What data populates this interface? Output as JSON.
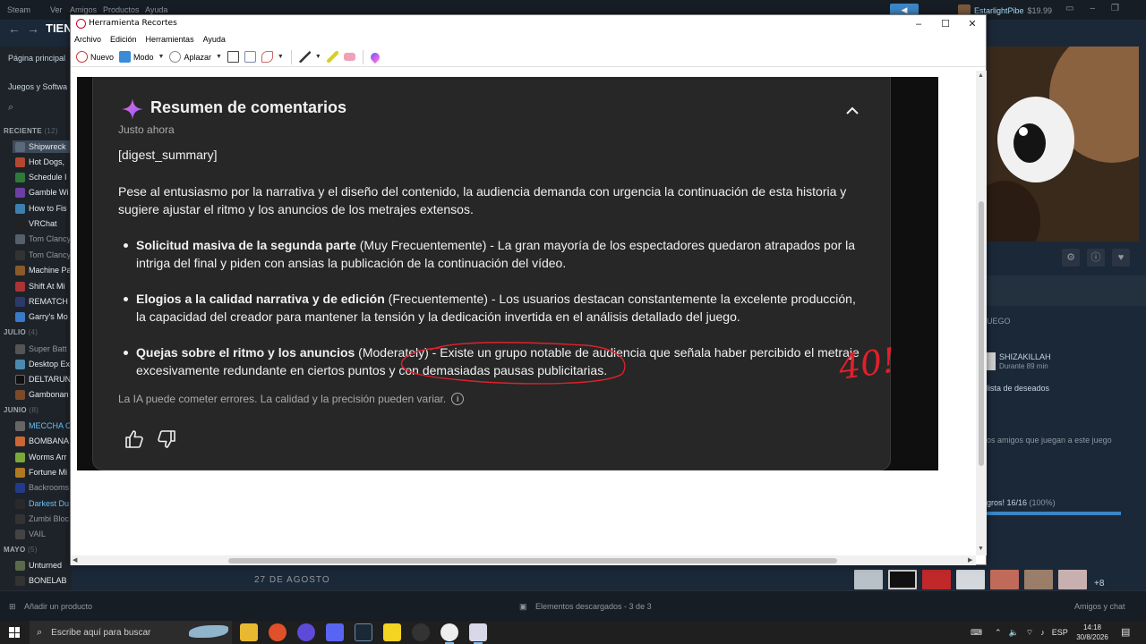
{
  "steam": {
    "menu": [
      "Steam",
      "Ver",
      "Amigos",
      "Productos",
      "Ayuda"
    ],
    "account_name": "EstarlightPibe",
    "balance": "$19.99",
    "store_label": "TIEN",
    "sidebar": {
      "home": "Página principal",
      "filter": "Juegos y Softwa",
      "sections": [
        {
          "label": "RECIENTE",
          "count": "(12)"
        },
        {
          "label": "JULIO",
          "count": "(4)"
        },
        {
          "label": "JUNIO",
          "count": "(8)"
        },
        {
          "label": "MAYO",
          "count": "(5)"
        }
      ],
      "games": [
        "Shipwreck",
        "Hot Dogs,",
        "Schedule I",
        "Gamble Wi",
        "How to Fis",
        "VRChat",
        "Tom Clancy",
        "Tom Clancy",
        "Machine Pa",
        "Shift At Mi",
        "REMATCH",
        "Garry's Mo",
        "Super Batt",
        "Desktop Ex",
        "DELTARUN",
        "Gambonan",
        "MECCHA C",
        "BOMBANA",
        "Worms Arr",
        "Fortune Mi",
        "Backrooms",
        "Darkest Du",
        "Zumbi Bloc",
        "VAIL",
        "Unturned",
        "BONELAB"
      ]
    },
    "right_panel": {
      "section_label": "UEGO",
      "friend_name": "SHIZAKILLAH",
      "friend_status": "Durante 89 min",
      "wishlist": "lista de deseados",
      "friends_playing": "os amigos que juegan a este juego",
      "achievements": "gros! 16/16",
      "achievements_pct": "(100%)",
      "achievements_fraction": 1.0
    },
    "date_label": "27 DE AGOSTO",
    "more_screenshots": "+8",
    "add_product": "Añadir un producto",
    "downloads": "Elementos descargados - 3 de 3",
    "friends_chat": "Amigos y chat"
  },
  "taskbar": {
    "search_placeholder": "Escribe aquí para buscar",
    "language": "ESP",
    "time": "14:18",
    "date": "30/8/2026"
  },
  "snip": {
    "title": "Herramienta Recortes",
    "menu": [
      "Archivo",
      "Edición",
      "Herramientas",
      "Ayuda"
    ],
    "toolbar": {
      "new": "Nuevo",
      "mode": "Modo",
      "delay": "Aplazar"
    }
  },
  "capture": {
    "title": "Resumen de comentarios",
    "time": "Justo ahora",
    "digest": "[digest_summary]",
    "intro": "Pese al entusiasmo por la narrativa y el diseño del contenido, la audiencia demanda con urgencia la continuación de esta historia y sugiere ajustar el ritmo y los anuncios de los metrajes extensos.",
    "bullets": [
      {
        "bold": "Solicitud masiva de la segunda parte",
        "rest": " (Muy Frecuentemente) - La gran mayoría de los espectadores quedaron atrapados por la intriga del final y piden con ansias la publicación de la continuación del vídeo."
      },
      {
        "bold": "Elogios a la calidad narrativa y de edición",
        "rest": " (Frecuentemente) - Los usuarios destacan constantemente la excelente producción, la capacidad del creador para mantener la tensión y la dedicación invertida en el análisis detallado del juego."
      },
      {
        "bold": "Quejas sobre el ritmo y los anuncios",
        "rest": " (Moderately) - Existe un grupo notable de audiencia que señala haber percibido el metraje excesivamente redundante en ciertos puntos y con demasiadas pausas publicitarias."
      }
    ],
    "disclaimer": "La IA puede cometer errores. La calidad y la precisión pueden variar.",
    "annotation_text": "40!",
    "colors": {
      "ink": "#e0202a",
      "sparkle_from": "#ff6bd6",
      "sparkle_to": "#7a5cff"
    }
  }
}
